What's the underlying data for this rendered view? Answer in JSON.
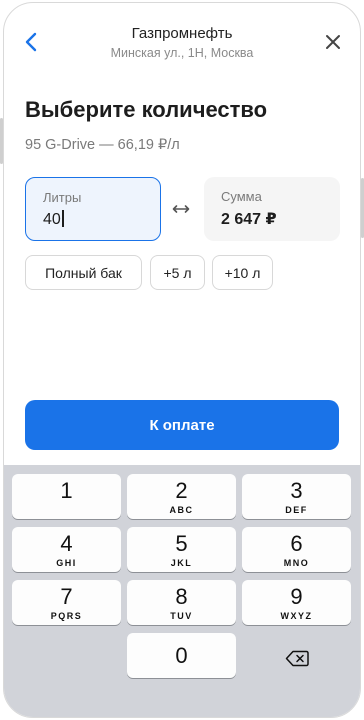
{
  "header": {
    "title": "Газпромнефть",
    "address": "Минская ул., 1Н, Москва"
  },
  "main": {
    "title": "Выберите количество",
    "fuel_info": "95 G-Drive — 66,19 ₽/л",
    "liters_field": {
      "label": "Литры",
      "value": "40"
    },
    "sum_field": {
      "label": "Сумма",
      "value": "2 647 ₽"
    },
    "chips": [
      "Полный бак",
      "+5 л",
      "+10 л"
    ],
    "pay_button": "К оплате"
  },
  "keypad": {
    "keys": [
      {
        "digit": "1",
        "letters": ""
      },
      {
        "digit": "2",
        "letters": "ABC"
      },
      {
        "digit": "3",
        "letters": "DEF"
      },
      {
        "digit": "4",
        "letters": "GHI"
      },
      {
        "digit": "5",
        "letters": "JKL"
      },
      {
        "digit": "6",
        "letters": "MNO"
      },
      {
        "digit": "7",
        "letters": "PQRS"
      },
      {
        "digit": "8",
        "letters": "TUV"
      },
      {
        "digit": "9",
        "letters": "WXYZ"
      },
      {
        "digit": "0",
        "letters": ""
      }
    ]
  },
  "colors": {
    "accent": "#1a73e8",
    "active_field_bg": "#eef4fd",
    "keypad_bg": "#d1d3d9"
  },
  "icons": [
    "back-arrow-icon",
    "close-icon",
    "swap-arrows-icon",
    "backspace-icon"
  ]
}
